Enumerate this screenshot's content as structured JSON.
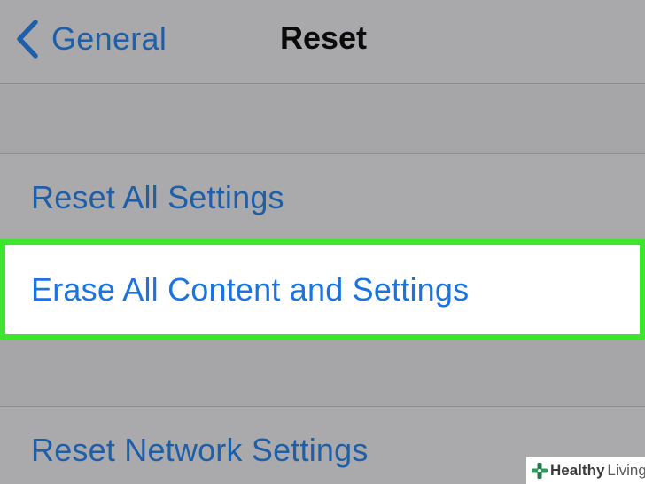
{
  "navbar": {
    "back_label": "General",
    "title": "Reset"
  },
  "settings": {
    "reset_all": "Reset All Settings",
    "erase_all": "Erase All Content and Settings",
    "reset_network": "Reset Network Settings"
  },
  "watermark": {
    "brand_bold": "Healthy",
    "brand_light": "Living"
  },
  "colors": {
    "link_blue": "#1f5fa8",
    "highlight_border": "#3ee42e",
    "background_gray": "#a7a7aa"
  },
  "icons": {
    "back": "chevron-left-icon",
    "watermark_logo": "cross-logo-icon"
  }
}
